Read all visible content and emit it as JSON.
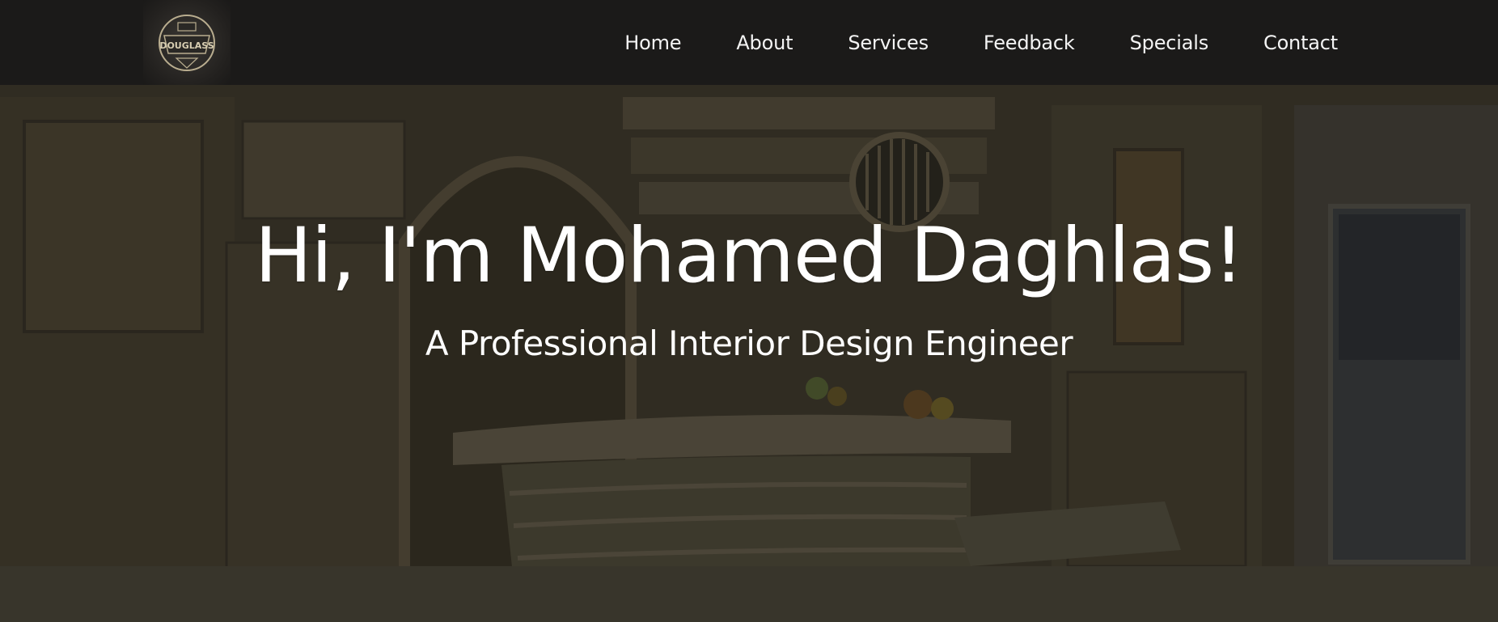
{
  "brand": {
    "logo_text": "DOUGLASS",
    "logo_icon": "badge-logo"
  },
  "nav": {
    "items": [
      {
        "label": "Home"
      },
      {
        "label": "About"
      },
      {
        "label": "Services"
      },
      {
        "label": "Feedback"
      },
      {
        "label": "Specials"
      },
      {
        "label": "Contact"
      }
    ]
  },
  "hero": {
    "title": "Hi, I'm Mohamed Daghlas!",
    "subtitle": "A Professional Interior Design Engineer",
    "background_image": "interior-kitchen-photo"
  },
  "colors": {
    "navbar_bg": "#1b1a19",
    "text": "#ffffff"
  }
}
